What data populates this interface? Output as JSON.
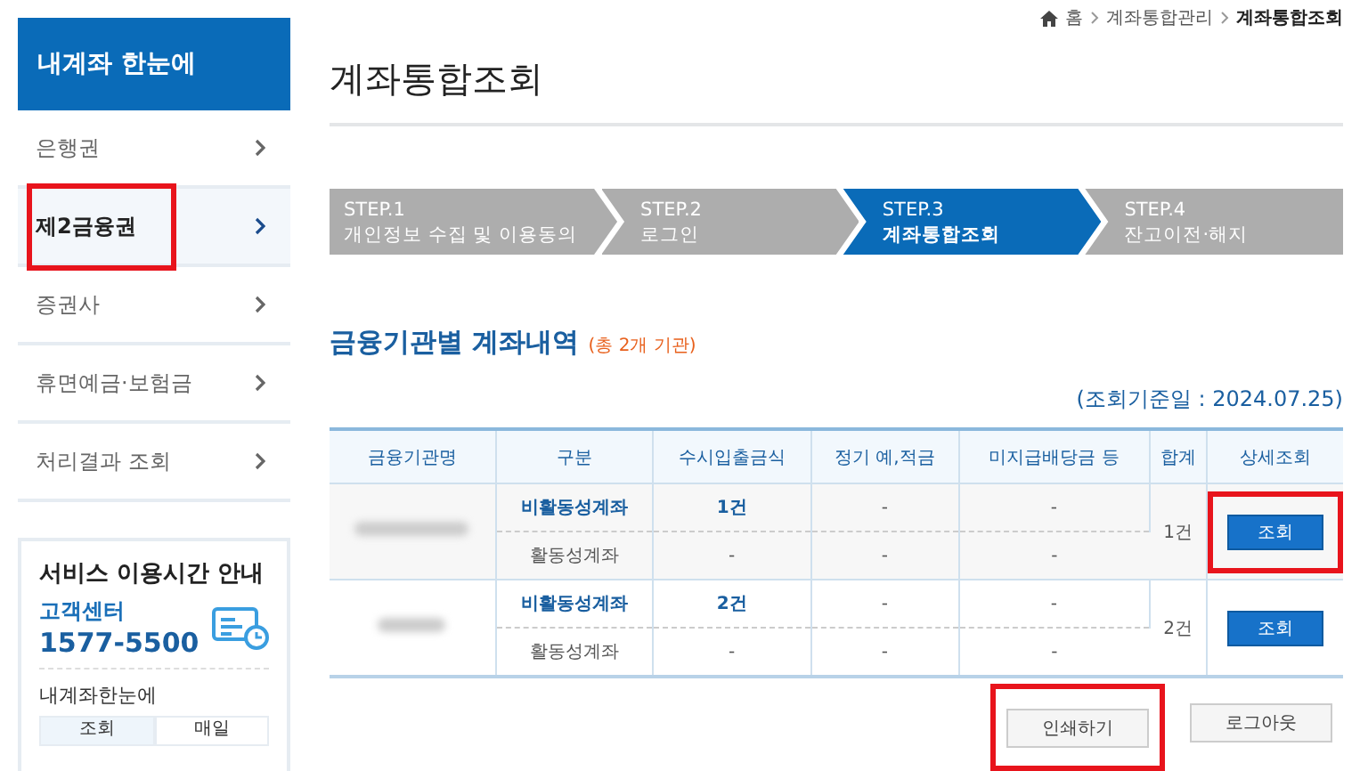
{
  "sidebar": {
    "title": "내계좌 한눈에",
    "items": [
      {
        "label": "은행권",
        "selected": false,
        "highlighted": false
      },
      {
        "label": "제2금융권",
        "selected": true,
        "highlighted": true
      },
      {
        "label": "증권사",
        "selected": false,
        "highlighted": false
      },
      {
        "label": "휴면예금·보험금",
        "selected": false,
        "highlighted": false
      },
      {
        "label": "처리결과 조회",
        "selected": false,
        "highlighted": false
      }
    ],
    "service": {
      "title": "서비스 이용시간 안내",
      "center_label": "고객센터",
      "phone": "1577-5500",
      "subtitle": "내계좌한눈에",
      "table_headers": [
        "조회",
        "매일"
      ]
    }
  },
  "breadcrumb": [
    "홈",
    "계좌통합관리",
    "계좌통합조회"
  ],
  "page_title": "계좌통합조회",
  "steps": [
    {
      "step": "STEP.1",
      "label": "개인정보 수집 및 이용동의",
      "selected": false
    },
    {
      "step": "STEP.2",
      "label": "로그인",
      "selected": false
    },
    {
      "step": "STEP.3",
      "label": "계좌통합조회",
      "selected": true
    },
    {
      "step": "STEP.4",
      "label": "잔고이전·해지",
      "selected": false
    }
  ],
  "section": {
    "title": "금융기관별 계좌내역",
    "count_note": "(총 2개 기관)"
  },
  "as_of": "(조회기준일 : 2024.07.25)",
  "table": {
    "columns": [
      "금융기관명",
      "구분",
      "수시입출금식",
      "정기 예,적금",
      "미지급배당금 등",
      "합계",
      "상세조회"
    ],
    "rows": [
      {
        "sub": [
          {
            "type": "비활동성계좌",
            "kind": "inactive",
            "demand": "1건",
            "term": "-",
            "dividend": "-"
          },
          {
            "type": "활동성계좌",
            "kind": "active",
            "demand": "-",
            "term": "-",
            "dividend": "-"
          }
        ],
        "total": "1건",
        "button": "조회",
        "highlighted": true
      },
      {
        "sub": [
          {
            "type": "비활동성계좌",
            "kind": "inactive",
            "demand": "2건",
            "term": "-",
            "dividend": "-"
          },
          {
            "type": "활동성계좌",
            "kind": "active",
            "demand": "-",
            "term": "-",
            "dividend": "-"
          }
        ],
        "total": "2건",
        "button": "조회",
        "highlighted": false
      }
    ]
  },
  "buttons": [
    {
      "label": "인쇄하기",
      "highlighted": true
    },
    {
      "label": "로그아웃",
      "highlighted": false
    }
  ]
}
